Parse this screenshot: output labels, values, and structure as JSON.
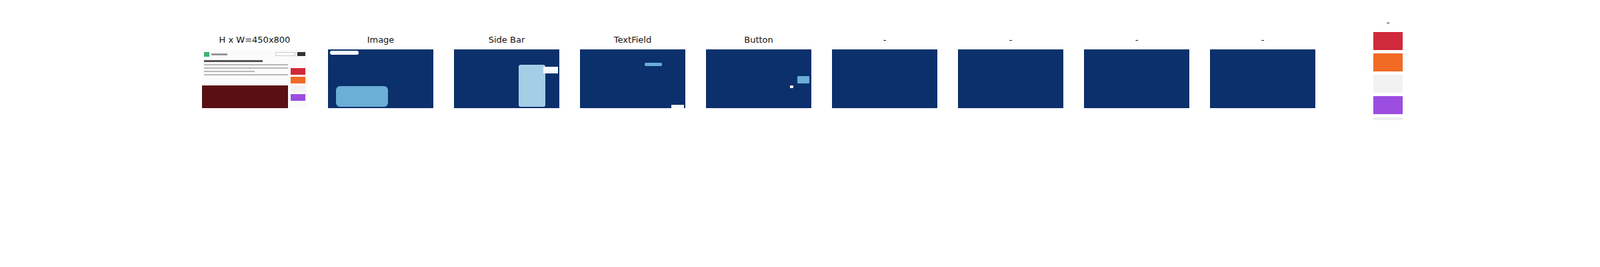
{
  "figure": {
    "size_label": "H x W=450x800"
  },
  "panels": [
    {
      "title": "Image"
    },
    {
      "title": "Side Bar"
    },
    {
      "title": "TextField"
    },
    {
      "title": "Button"
    },
    {
      "title": "-"
    },
    {
      "title": "-"
    },
    {
      "title": "-"
    },
    {
      "title": "-"
    }
  ],
  "side_thumbnail": {
    "title": "-",
    "ads": [
      {
        "color": "#d0293b"
      },
      {
        "color": "#f06a24"
      },
      {
        "color": "#f2f2f2"
      },
      {
        "color": "#9b4de0"
      }
    ]
  }
}
